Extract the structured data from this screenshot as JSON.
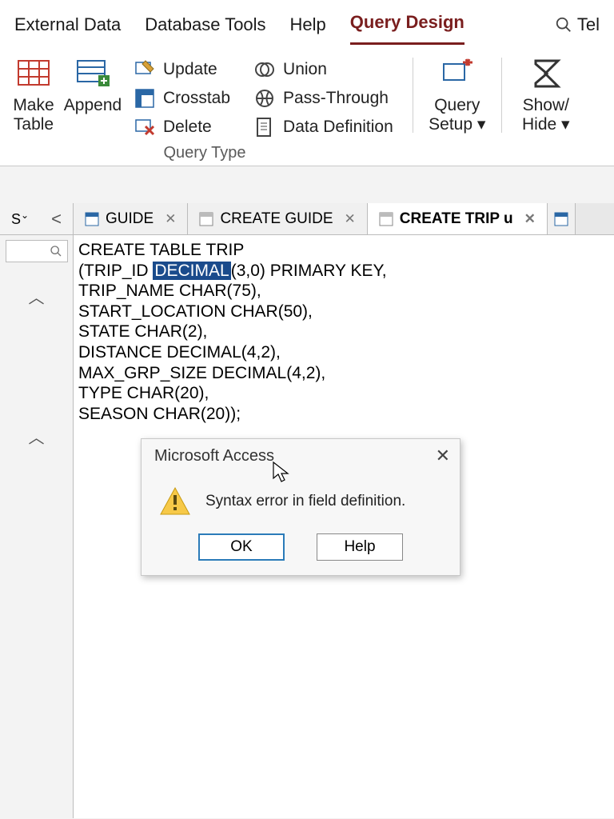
{
  "menu": {
    "items": [
      "External Data",
      "Database Tools",
      "Help",
      "Query Design"
    ],
    "active_index": 3,
    "search_hint": "Tel"
  },
  "ribbon": {
    "big": [
      {
        "label": "Make\nTable"
      },
      {
        "label": "Append"
      }
    ],
    "query_type_group_label": "Query Type",
    "small_col1": [
      "Update",
      "Crosstab",
      "Delete"
    ],
    "small_col2": [
      "Union",
      "Pass-Through",
      "Data Definition"
    ],
    "right": [
      {
        "label": "Query\nSetup",
        "dropdown": true
      },
      {
        "label": "Show/\nHide",
        "dropdown": true
      }
    ]
  },
  "tabs": {
    "left_caret": "<",
    "items": [
      {
        "label": "GUIDE",
        "active": false
      },
      {
        "label": "CREATE GUIDE",
        "active": false
      },
      {
        "label": "CREATE TRIP u",
        "active": true
      }
    ]
  },
  "sql": {
    "lines": [
      {
        "pre": "CREATE TABLE TRIP"
      },
      {
        "pre": "(TRIP_ID ",
        "hl": "DECIMAL",
        "post": "(3,0) PRIMARY KEY,"
      },
      {
        "pre": "TRIP_NAME CHAR(75),"
      },
      {
        "pre": "START_LOCATION CHAR(50),"
      },
      {
        "pre": "STATE CHAR(2),"
      },
      {
        "pre": "DISTANCE DECIMAL(4,2),"
      },
      {
        "pre": "MAX_GRP_SIZE DECIMAL(4,2),"
      },
      {
        "pre": "TYPE CHAR(20),"
      },
      {
        "pre": "SEASON CHAR(20));"
      }
    ]
  },
  "dialog": {
    "title": "Microsoft Access",
    "message": "Syntax error in field definition.",
    "ok": "OK",
    "help": "Help"
  }
}
